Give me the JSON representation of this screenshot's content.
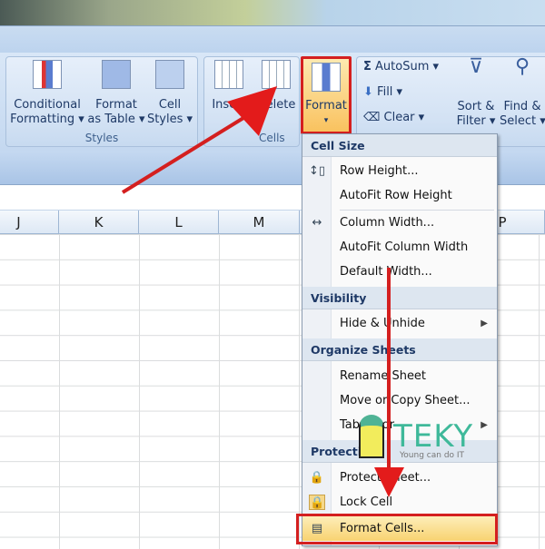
{
  "ribbon": {
    "styles": {
      "label": "Styles",
      "conditional": "Conditional\nFormatting ▾",
      "format_table": "Format\nas Table ▾",
      "cell_styles": "Cell\nStyles ▾"
    },
    "cells": {
      "label": "Cells",
      "insert": "Insert",
      "delete": "Delete",
      "format": "Format"
    },
    "editing": {
      "autosum": "AutoSum",
      "fill": "Fill",
      "clear": "Clear",
      "sort": "Sort &\nFilter ▾",
      "find": "Find &\nSelect ▾"
    }
  },
  "columns": [
    "J",
    "K",
    "L",
    "M",
    "P"
  ],
  "menu": {
    "sections": [
      {
        "header": "Cell Size",
        "items": [
          "Row Height...",
          "AutoFit Row Height",
          "Column Width...",
          "AutoFit Column Width",
          "Default Width..."
        ]
      },
      {
        "header": "Visibility",
        "items": [
          "Hide & Unhide"
        ]
      },
      {
        "header": "Organize Sheets",
        "items": [
          "Rename Sheet",
          "Move or Copy Sheet...",
          "Tab Color"
        ]
      },
      {
        "header": "Protection",
        "items": [
          "Protect Sheet...",
          "Lock Cell",
          "Format Cells..."
        ]
      }
    ]
  },
  "watermark": {
    "brand": "TEKY",
    "tagline": "Young can do IT"
  },
  "colors": {
    "highlight": "#d41f1f",
    "accent": "#1e3966"
  }
}
